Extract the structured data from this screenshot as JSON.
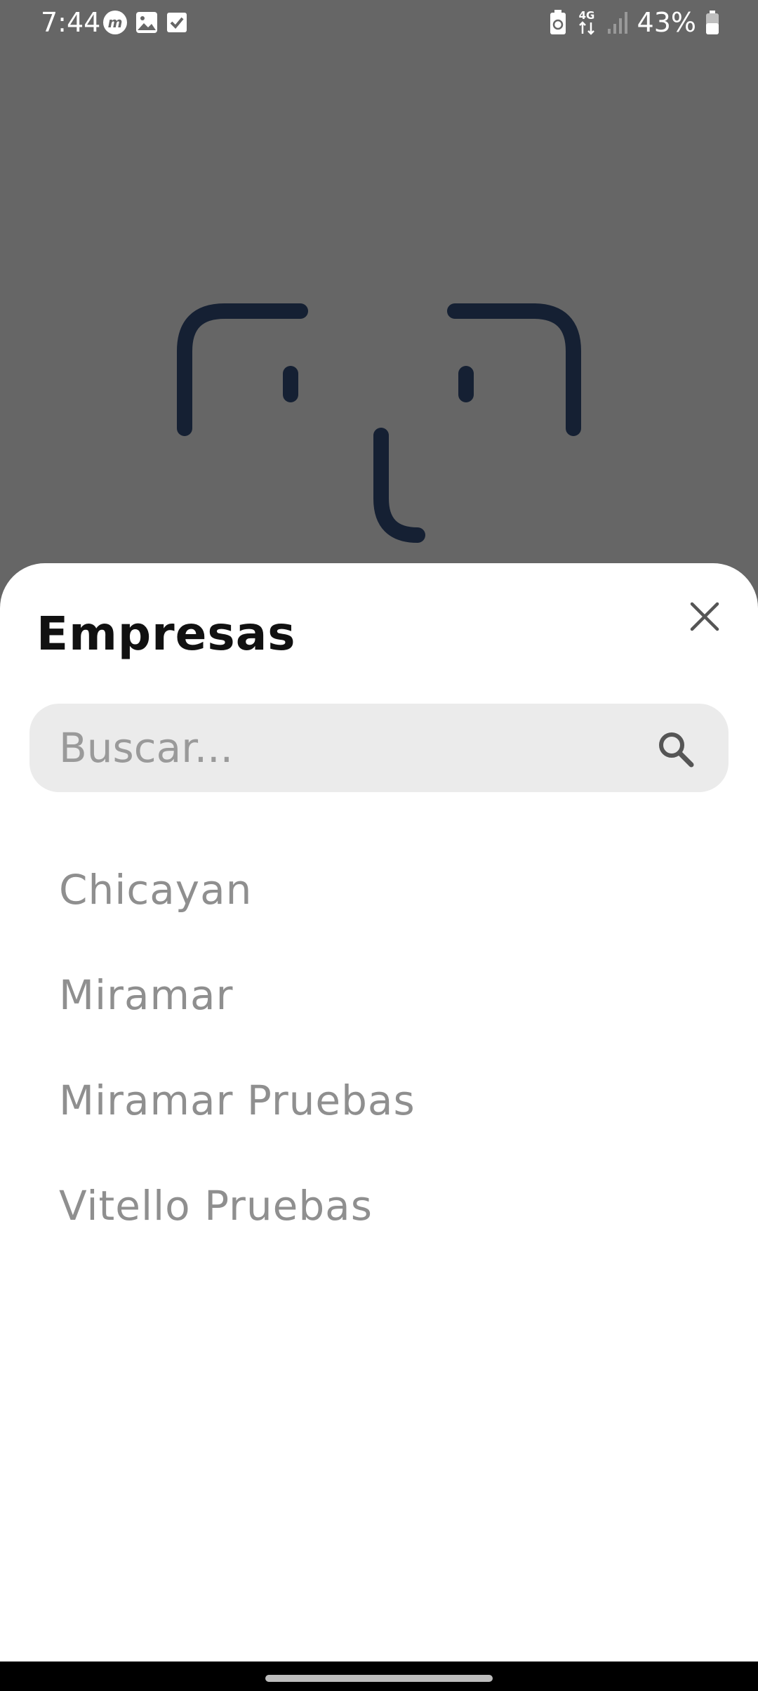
{
  "status_bar": {
    "time": "7:44",
    "battery_percent": "43%",
    "network": "4G",
    "left_icons": [
      "m-app-icon",
      "image-icon",
      "checkbox-icon"
    ],
    "right_icons": [
      "battery-saver-icon",
      "network-4g-icon",
      "signal-icon",
      "battery-icon"
    ]
  },
  "background": {
    "color": "#666666",
    "logo": "face-logo-icon",
    "logo_color": "#152033"
  },
  "sheet": {
    "title": "Empresas",
    "close_icon": "close-icon",
    "search": {
      "placeholder": "Buscar...",
      "value": "",
      "icon": "search-icon"
    },
    "companies": [
      "Chicayan",
      "Miramar",
      "Miramar Pruebas",
      "Vitello Pruebas"
    ]
  },
  "colors": {
    "sheet_background": "#ffffff",
    "title_text": "#111111",
    "item_text": "#8f8f8f",
    "search_background": "#ebebeb",
    "placeholder_text": "#9a9a9a"
  }
}
